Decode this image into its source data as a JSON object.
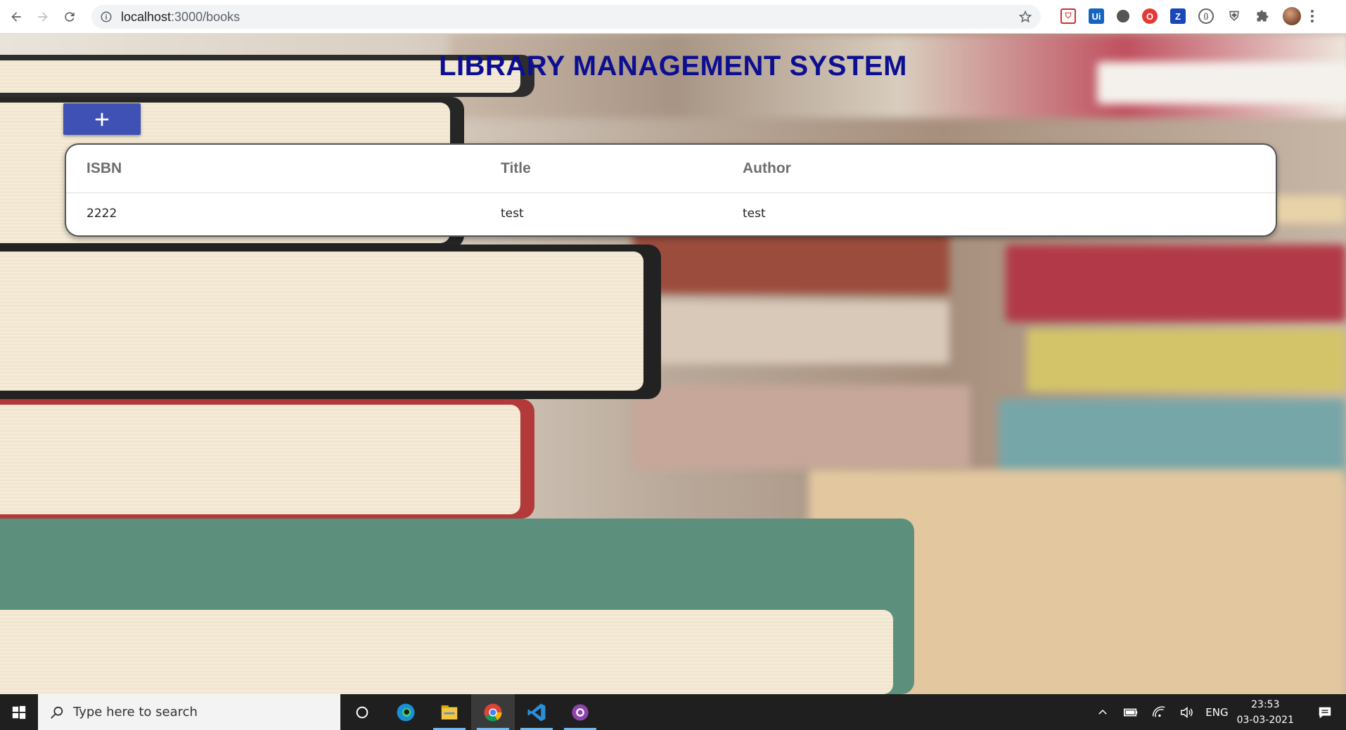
{
  "browser": {
    "url_host": "localhost",
    "url_path": ":3000/books"
  },
  "page": {
    "title": "LIBRARY MANAGEMENT SYSTEM",
    "add_button_label": "+"
  },
  "table": {
    "columns": [
      "ISBN",
      "Title",
      "Author"
    ],
    "rows": [
      {
        "isbn": "2222",
        "title": "test",
        "author": "test"
      }
    ]
  },
  "taskbar": {
    "search_placeholder": "Type here to search",
    "language": "ENG",
    "time": "23:53",
    "date": "03-03-2021"
  },
  "colors": {
    "title": "#0d0f91",
    "add_button": "#3f51b5"
  }
}
